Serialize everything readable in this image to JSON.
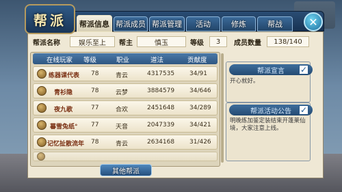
{
  "title": "帮派",
  "close_symbol": "✕",
  "tabs": [
    {
      "label": "帮派信息",
      "active": true
    },
    {
      "label": "帮派成员",
      "active": false
    },
    {
      "label": "帮派管理",
      "active": false
    },
    {
      "label": "活动",
      "active": false
    },
    {
      "label": "修炼",
      "active": false
    },
    {
      "label": "帮战",
      "active": false
    }
  ],
  "guild": {
    "name_label": "帮派名称",
    "name": "娱乐至上",
    "leader_label": "帮主",
    "leader": "慎玉",
    "level_label": "等级",
    "level": "3",
    "members_label": "成员数量",
    "members": "138/140"
  },
  "table": {
    "headers": [
      "在线玩家",
      "等级",
      "职业",
      "道法",
      "贡献度"
    ],
    "rows": [
      {
        "name": "练器课代表",
        "level": "78",
        "class": "青云",
        "power": "4317535",
        "contribution": "34/91"
      },
      {
        "name": "青衫隐",
        "level": "78",
        "class": "云梦",
        "power": "3884579",
        "contribution": "34/646"
      },
      {
        "name": "夜九歌",
        "level": "77",
        "class": "合欢",
        "power": "2451648",
        "contribution": "34/289"
      },
      {
        "name": "暮雪兔纸°",
        "level": "77",
        "class": "天音",
        "power": "2047339",
        "contribution": "34/421"
      },
      {
        "name": "记忆扯散流年",
        "level": "78",
        "class": "青云",
        "power": "2634168",
        "contribution": "31/426"
      }
    ]
  },
  "notice": {
    "title": "帮派宣言",
    "text": "开心就好。",
    "checked": true
  },
  "announce": {
    "title": "帮派活动公告",
    "text": "明晚练加鉴定装结束开蓬莱仙境，大家注意上线。",
    "checked": true
  },
  "check_symbol": "✓",
  "footer_button": "其他帮派",
  "colors": {
    "tab_active": "#efe6c6",
    "header_blue": "#224569",
    "panel": "#efe8d5"
  }
}
